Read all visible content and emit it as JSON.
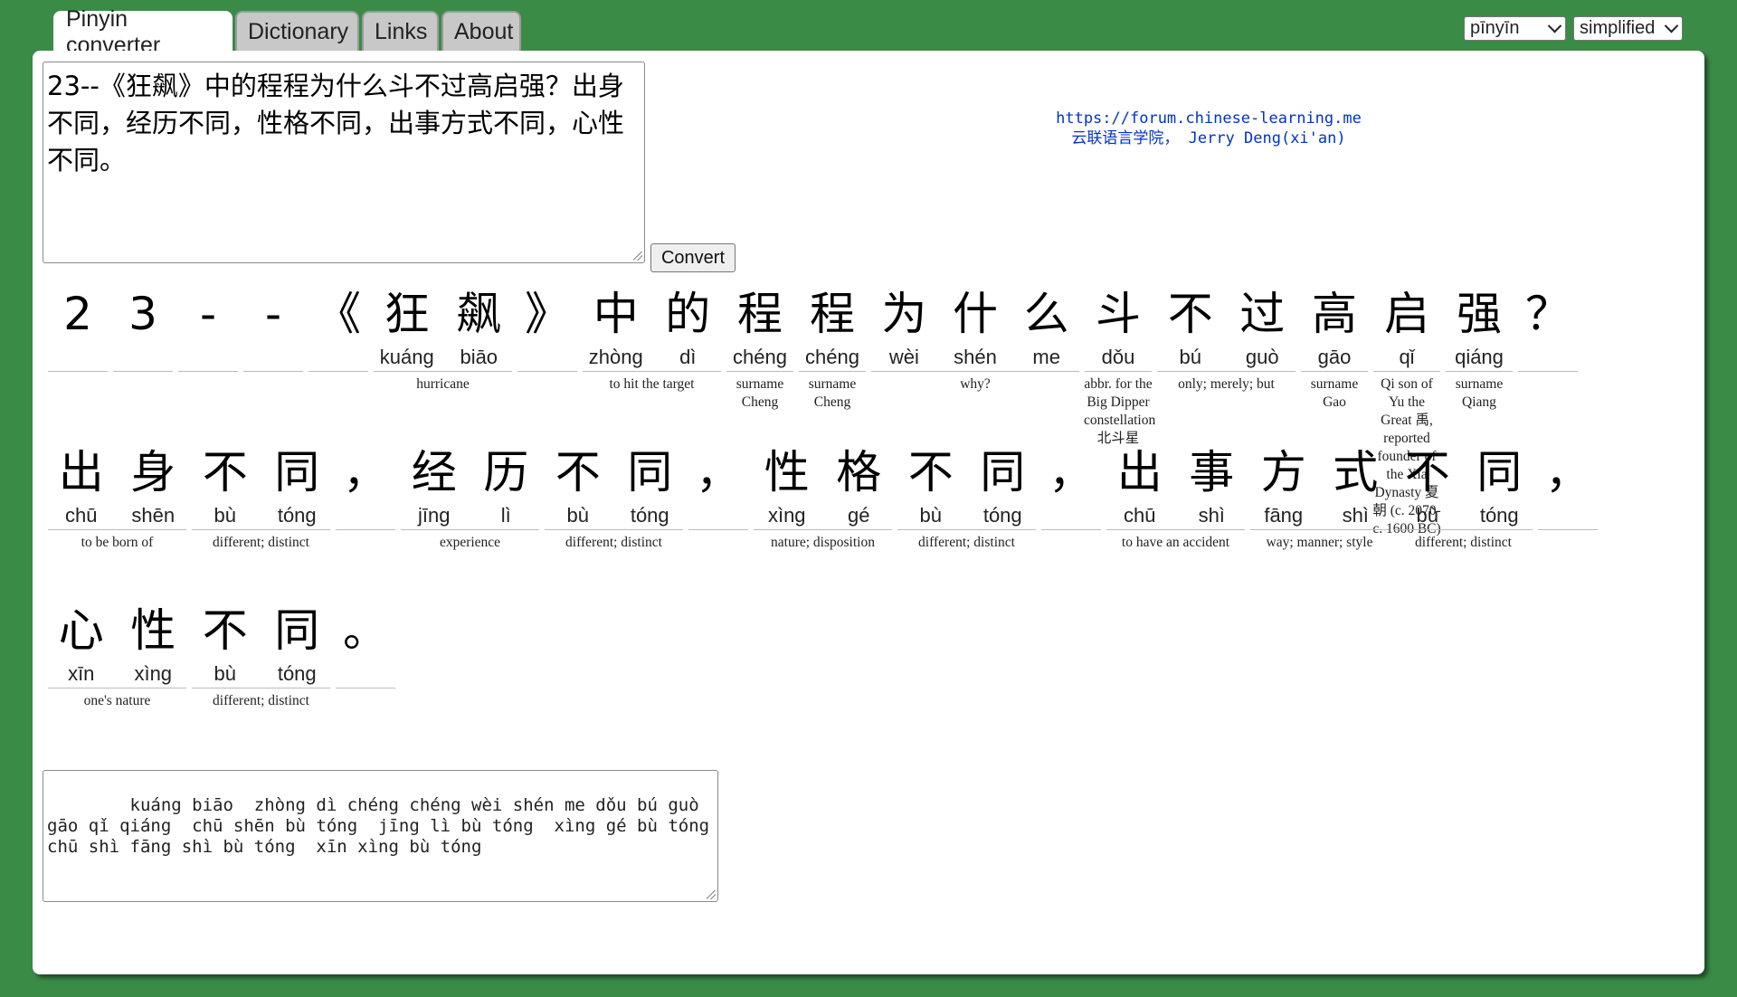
{
  "tabs": [
    {
      "label": "Pinyin converter",
      "active": true
    },
    {
      "label": "Dictionary",
      "active": false
    },
    {
      "label": "Links",
      "active": false
    },
    {
      "label": "About",
      "active": false
    }
  ],
  "selects": {
    "mode": "pīnyīn",
    "script": "simplified"
  },
  "input": {
    "text": "23--《狂飙》中的程程为什么斗不过高启强？出身不同，经历不同，性格不同，出事方式不同，心性不同。"
  },
  "convert_label": "Convert",
  "credits": {
    "url": "https://forum.chinese-learning.me",
    "author": "云联语言学院， Jerry Deng(xi'an)"
  },
  "rows": [
    [
      {
        "chars": [
          {
            "hz": "2",
            "py": ""
          }
        ],
        "def": ""
      },
      {
        "chars": [
          {
            "hz": "3",
            "py": ""
          }
        ],
        "def": ""
      },
      {
        "chars": [
          {
            "hz": "-",
            "py": ""
          }
        ],
        "def": ""
      },
      {
        "chars": [
          {
            "hz": "-",
            "py": ""
          }
        ],
        "def": ""
      },
      {
        "chars": [
          {
            "hz": "《",
            "py": ""
          }
        ],
        "def": ""
      },
      {
        "chars": [
          {
            "hz": "狂",
            "py": "kuáng"
          },
          {
            "hz": "飙",
            "py": "biāo"
          }
        ],
        "def": "hurricane"
      },
      {
        "chars": [
          {
            "hz": "》",
            "py": ""
          }
        ],
        "def": ""
      },
      {
        "chars": [
          {
            "hz": "中",
            "py": "zhòng"
          },
          {
            "hz": "的",
            "py": "dì"
          }
        ],
        "def": "to hit the target"
      },
      {
        "chars": [
          {
            "hz": "程",
            "py": "chéng"
          }
        ],
        "def": "surname Cheng"
      },
      {
        "chars": [
          {
            "hz": "程",
            "py": "chéng"
          }
        ],
        "def": "surname Cheng"
      },
      {
        "chars": [
          {
            "hz": "为",
            "py": "wèi"
          },
          {
            "hz": "什",
            "py": "shén"
          },
          {
            "hz": "么",
            "py": "me"
          }
        ],
        "def": "why?"
      },
      {
        "chars": [
          {
            "hz": "斗",
            "py": "dǒu"
          }
        ],
        "def": "abbr. for the Big Dipper constellation 北斗星"
      },
      {
        "chars": [
          {
            "hz": "不",
            "py": "bú"
          },
          {
            "hz": "过",
            "py": "guò"
          }
        ],
        "def": "only; merely; but"
      },
      {
        "chars": [
          {
            "hz": "高",
            "py": "gāo"
          }
        ],
        "def": "surname Gao"
      },
      {
        "chars": [
          {
            "hz": "启",
            "py": "qǐ"
          }
        ],
        "def": "Qi son of Yu the Great 禹, reported founder of the Xia Dynasty 夏朝 (c. 2070-c. 1600 BC)"
      },
      {
        "chars": [
          {
            "hz": "强",
            "py": "qiáng"
          }
        ],
        "def": "surname Qiang"
      },
      {
        "chars": [
          {
            "hz": "？",
            "py": ""
          }
        ],
        "def": ""
      }
    ],
    [
      {
        "chars": [
          {
            "hz": "出",
            "py": "chū"
          },
          {
            "hz": "身",
            "py": "shēn"
          }
        ],
        "def": "to be born of"
      },
      {
        "chars": [
          {
            "hz": "不",
            "py": "bù"
          },
          {
            "hz": "同",
            "py": "tóng"
          }
        ],
        "def": "different; distinct"
      },
      {
        "chars": [
          {
            "hz": "，",
            "py": ""
          }
        ],
        "def": ""
      },
      {
        "chars": [
          {
            "hz": "经",
            "py": "jīng"
          },
          {
            "hz": "历",
            "py": "lì"
          }
        ],
        "def": "experience"
      },
      {
        "chars": [
          {
            "hz": "不",
            "py": "bù"
          },
          {
            "hz": "同",
            "py": "tóng"
          }
        ],
        "def": "different; distinct"
      },
      {
        "chars": [
          {
            "hz": "，",
            "py": ""
          }
        ],
        "def": ""
      },
      {
        "chars": [
          {
            "hz": "性",
            "py": "xìng"
          },
          {
            "hz": "格",
            "py": "gé"
          }
        ],
        "def": "nature; disposition"
      },
      {
        "chars": [
          {
            "hz": "不",
            "py": "bù"
          },
          {
            "hz": "同",
            "py": "tóng"
          }
        ],
        "def": "different; distinct"
      },
      {
        "chars": [
          {
            "hz": "，",
            "py": ""
          }
        ],
        "def": ""
      },
      {
        "chars": [
          {
            "hz": "出",
            "py": "chū"
          },
          {
            "hz": "事",
            "py": "shì"
          }
        ],
        "def": "to have an accident"
      },
      {
        "chars": [
          {
            "hz": "方",
            "py": "fāng"
          },
          {
            "hz": "式",
            "py": "shì"
          }
        ],
        "def": "way; manner; style"
      },
      {
        "chars": [
          {
            "hz": "不",
            "py": "bù"
          },
          {
            "hz": "同",
            "py": "tóng"
          }
        ],
        "def": "different; distinct"
      },
      {
        "chars": [
          {
            "hz": "，",
            "py": ""
          }
        ],
        "def": ""
      }
    ],
    [
      {
        "chars": [
          {
            "hz": "心",
            "py": "xīn"
          },
          {
            "hz": "性",
            "py": "xìng"
          }
        ],
        "def": "one's nature"
      },
      {
        "chars": [
          {
            "hz": "不",
            "py": "bù"
          },
          {
            "hz": "同",
            "py": "tóng"
          }
        ],
        "def": "different; distinct"
      },
      {
        "chars": [
          {
            "hz": "。",
            "py": ""
          }
        ],
        "def": ""
      }
    ]
  ],
  "output": {
    "text": "    kuáng biāo  zhòng dì chéng chéng wèi shén me dǒu bú guò gāo qǐ qiáng  chū shēn bù tóng  jīng lì bù tóng  xìng gé bù tóng  chū shì fāng shì bù tóng  xīn xìng bù tóng"
  }
}
